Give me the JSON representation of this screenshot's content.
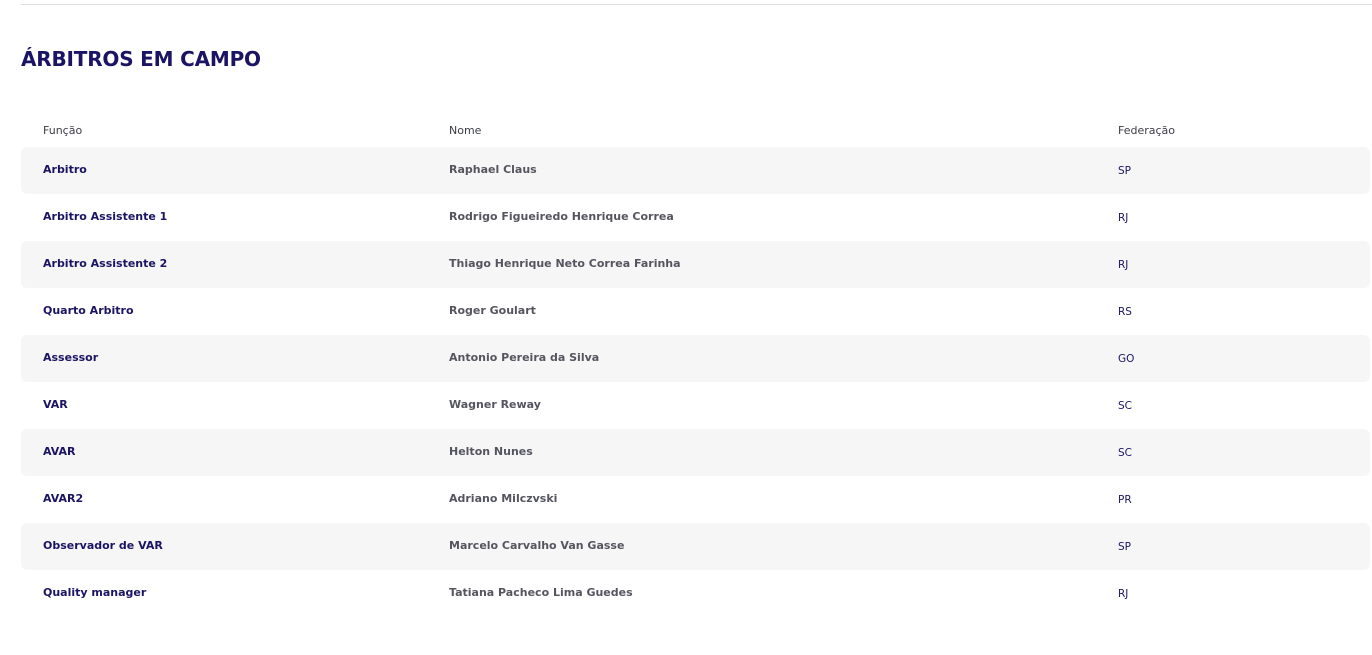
{
  "section": {
    "title": "ÁRBITROS EM CAMPO"
  },
  "table": {
    "headers": {
      "funcao": "Função",
      "nome": "Nome",
      "federacao": "Federação"
    },
    "rows": [
      {
        "funcao": "Arbitro",
        "nome": "Raphael Claus",
        "federacao": "SP"
      },
      {
        "funcao": "Arbitro Assistente 1",
        "nome": "Rodrigo Figueiredo Henrique Correa",
        "federacao": "RJ"
      },
      {
        "funcao": "Arbitro Assistente 2",
        "nome": "Thiago Henrique Neto Correa Farinha",
        "federacao": "RJ"
      },
      {
        "funcao": "Quarto Arbitro",
        "nome": "Roger Goulart",
        "federacao": "RS"
      },
      {
        "funcao": "Assessor",
        "nome": "Antonio Pereira da Silva",
        "federacao": "GO"
      },
      {
        "funcao": "VAR",
        "nome": "Wagner Reway",
        "federacao": "SC"
      },
      {
        "funcao": "AVAR",
        "nome": "Helton Nunes",
        "federacao": "SC"
      },
      {
        "funcao": "AVAR2",
        "nome": "Adriano Milczvski",
        "federacao": "PR"
      },
      {
        "funcao": "Observador de VAR",
        "nome": "Marcelo Carvalho Van Gasse",
        "federacao": "SP"
      },
      {
        "funcao": "Quality manager",
        "nome": "Tatiana Pacheco Lima Guedes",
        "federacao": "RJ"
      }
    ]
  },
  "colors": {
    "title": "#1b1464",
    "role_text": "#1b1464",
    "name_text": "#555560",
    "row_shade": "#f6f6f6",
    "divider": "#e0e0e0"
  }
}
